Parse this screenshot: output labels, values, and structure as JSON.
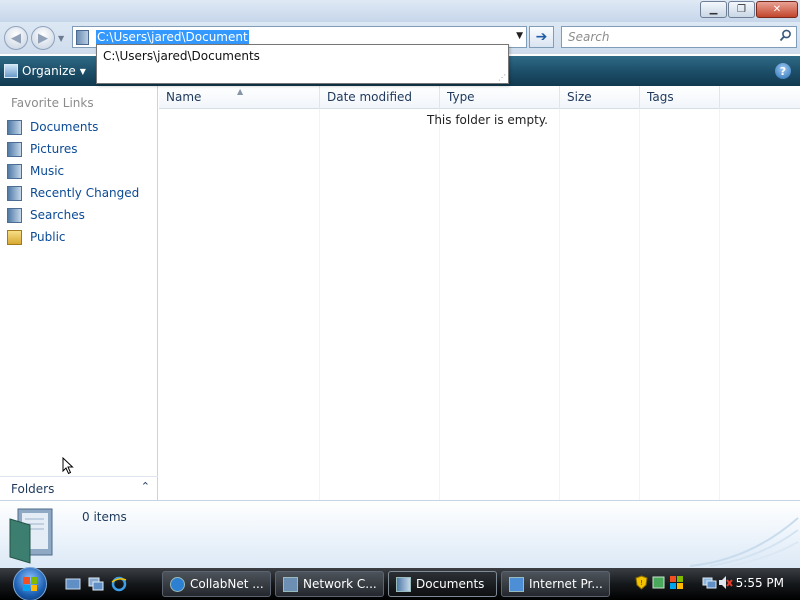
{
  "window": {
    "minimize_glyph": "▁",
    "maximize_glyph": "❐",
    "close_glyph": "✕"
  },
  "address": {
    "path": "C:\\Users\\jared\\Document",
    "go_glyph": "➔",
    "dropdown_glyph": "▼",
    "autocomplete_items": [
      "C:\\Users\\jared\\Documents"
    ]
  },
  "search": {
    "placeholder": "Search",
    "icon": "search-icon"
  },
  "commandbar": {
    "organize_label": "Organize",
    "help_glyph": "?"
  },
  "sidebar": {
    "heading": "Favorite Links",
    "items": [
      {
        "label": "Documents",
        "icon": "documents-icon"
      },
      {
        "label": "Pictures",
        "icon": "pictures-icon"
      },
      {
        "label": "Music",
        "icon": "music-icon"
      },
      {
        "label": "Recently Changed",
        "icon": "recently-changed-icon"
      },
      {
        "label": "Searches",
        "icon": "searches-icon"
      },
      {
        "label": "Public",
        "icon": "public-folder-icon"
      }
    ],
    "folders_label": "Folders",
    "folders_chevron": "⌃"
  },
  "filelist": {
    "columns": [
      "Name",
      "Date modified",
      "Type",
      "Size",
      "Tags"
    ],
    "empty_message": "This folder is empty."
  },
  "details": {
    "item_count": "0 items"
  },
  "taskbar": {
    "tasks": [
      {
        "label": "CollabNet ...",
        "icon": "internet-explorer-icon"
      },
      {
        "label": "Network C...",
        "icon": "network-icon"
      },
      {
        "label": "Documents",
        "icon": "documents-icon",
        "active": true
      },
      {
        "label": "Internet Pr...",
        "icon": "internet-properties-icon"
      }
    ],
    "clock": "5:55 PM"
  },
  "colors": {
    "accent": "#1d4f69",
    "link": "#0b4a95",
    "selection": "#3399ff"
  }
}
